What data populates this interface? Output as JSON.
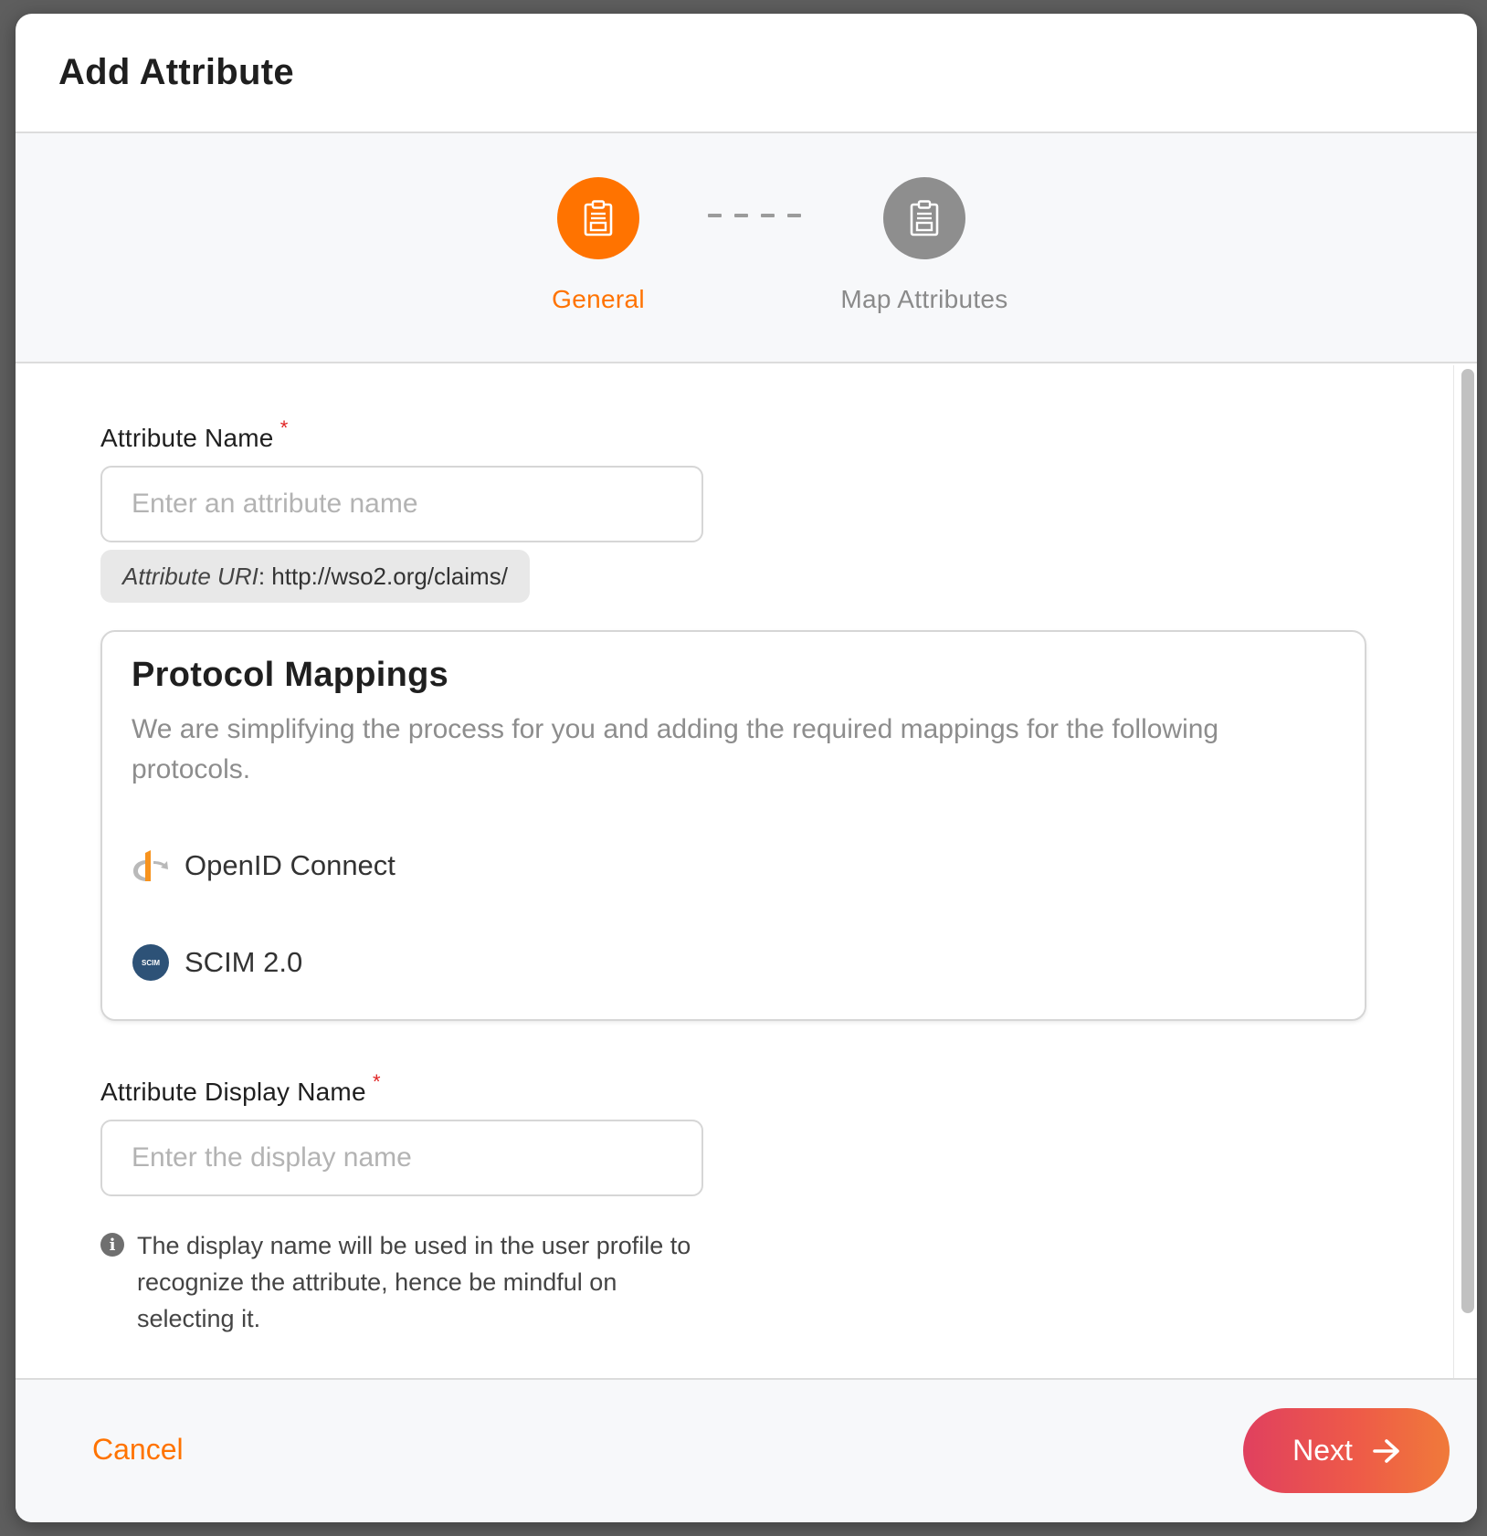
{
  "modal": {
    "title": "Add Attribute"
  },
  "stepper": {
    "steps": [
      {
        "label": "General",
        "state": "active",
        "icon": "clipboard-icon"
      },
      {
        "label": "Map Attributes",
        "state": "inactive",
        "icon": "clipboard-icon"
      }
    ]
  },
  "form": {
    "attribute_name": {
      "label": "Attribute Name",
      "required_mark": "*",
      "value": "",
      "placeholder": "Enter an attribute name"
    },
    "attribute_uri": {
      "prefix": "Attribute URI",
      "separator": ":",
      "value": " http://wso2.org/claims/"
    },
    "protocol_mappings": {
      "title": "Protocol Mappings",
      "description": "We are simplifying the process for you and adding the required mappings for the following protocols.",
      "protocols": [
        {
          "name": "OpenID Connect",
          "icon": "openid-icon"
        },
        {
          "name": "SCIM 2.0",
          "icon": "scim-icon",
          "badge_text": "SCIM"
        }
      ]
    },
    "display_name": {
      "label": "Attribute Display Name",
      "required_mark": "*",
      "value": "",
      "placeholder": "Enter the display name",
      "hint": "The display name will be used in the user profile to recognize the attribute, hence be mindful on selecting it.",
      "hint_icon": "info-icon"
    }
  },
  "footer": {
    "cancel_label": "Cancel",
    "next_label": "Next",
    "next_icon": "arrow-right-icon"
  },
  "colors": {
    "accent": "#ff7300",
    "inactive_step": "#8e8e8e",
    "required": "#e02424",
    "scim_badge": "#2d5277",
    "next_gradient_start": "#e0405f",
    "next_gradient_end": "#f07a3a"
  }
}
